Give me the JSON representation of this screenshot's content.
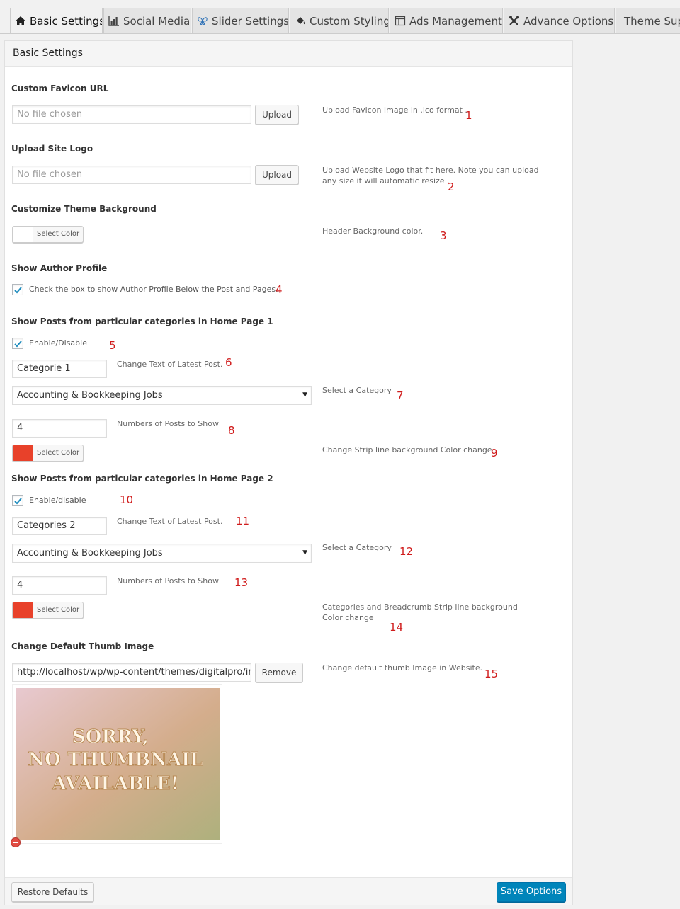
{
  "tabs": [
    {
      "label": "Basic Settings",
      "icon": "home-icon",
      "active": true
    },
    {
      "label": "Social Media",
      "icon": "chart-icon"
    },
    {
      "label": "Slider Settings",
      "icon": "butterfly-icon"
    },
    {
      "label": "Custom Styling",
      "icon": "paint-bucket-icon"
    },
    {
      "label": "Ads Management",
      "icon": "layout-icon"
    },
    {
      "label": "Advance Options",
      "icon": "tools-icon"
    },
    {
      "label": "Theme Support",
      "icon": ""
    }
  ],
  "panel": {
    "title": "Basic Settings"
  },
  "favicon": {
    "label": "Custom Favicon URL",
    "placeholder": "No file chosen",
    "button": "Upload",
    "desc": "Upload Favicon Image in .ico format .",
    "num": "1"
  },
  "logo": {
    "label": "Upload Site Logo",
    "placeholder": "No file chosen",
    "button": "Upload",
    "desc": "Upload Website Logo that fit here. Note you can upload any size it will automatic resize .",
    "num": "2"
  },
  "background": {
    "label": "Customize Theme Background",
    "color_button": "Select Color",
    "color": "#ffffff",
    "desc": "Header Background color.",
    "num": "3"
  },
  "author": {
    "label": "Show Author Profile",
    "checkbox_label": "Check the box to show Author Profile Below the Post and Pages.",
    "checked": true,
    "num": "4"
  },
  "home1": {
    "label": "Show Posts from particular categories in Home Page 1",
    "enable_label": "Enable/Disable",
    "enable_num": "5",
    "text_value": "Categorie 1",
    "text_desc": "Change Text of Latest Post.",
    "text_num": "6",
    "category": "Accounting & Bookkeeping Jobs",
    "category_desc": "Select a Category",
    "category_num": "7",
    "posts_value": "4",
    "posts_desc": "Numbers of Posts to Show",
    "posts_num": "8",
    "color_button": "Select Color",
    "color": "#e8412a",
    "color_desc": "Change Strip line background Color change",
    "color_num": "9"
  },
  "home2": {
    "label": "Show Posts from particular categories in Home Page 2",
    "enable_label": "Enable/disable",
    "enable_num": "10",
    "text_value": "Categories 2",
    "text_desc": "Change Text of Latest Post.",
    "text_num": "11",
    "category": "Accounting & Bookkeeping Jobs",
    "category_desc": "Select a Category",
    "category_num": "12",
    "posts_value": "4",
    "posts_desc": "Numbers of Posts to Show",
    "posts_num": "13",
    "color_button": "Select Color",
    "color": "#e8412a",
    "color_desc": "Categories and Breadcrumb Strip line background Color change",
    "color_num": "14"
  },
  "thumb": {
    "label": "Change Default Thumb Image",
    "url": "http://localhost/wp/wp-content/themes/digitalpro/images/no-thumbnail.jpg",
    "button": "Remove",
    "desc": "Change default thumb Image in Website.",
    "num": "15",
    "image_lines": [
      "SORRY,",
      "NO THUMBNAIL",
      "AVAILABLE!"
    ]
  },
  "footer": {
    "restore": "Restore Defaults",
    "save": "Save Options"
  },
  "colors": {
    "accent": "#0085ba",
    "number_annotation": "#d01c1c",
    "strip": "#e8412a"
  }
}
